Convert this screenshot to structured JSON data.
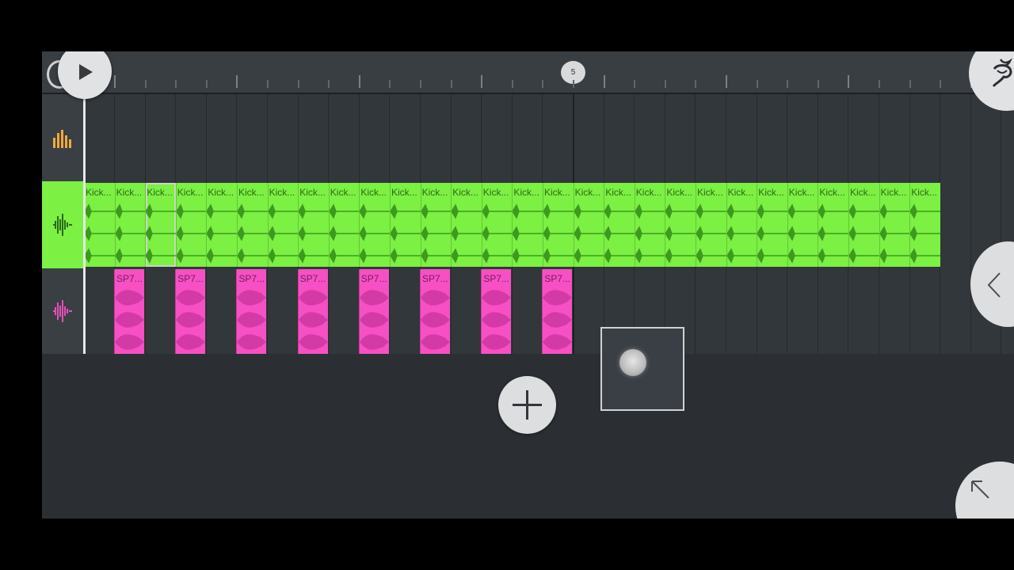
{
  "ruler": {
    "bar_marker": "5"
  },
  "tracks": [
    {
      "name": "track-1-mixer",
      "icon": "mixer-bars-icon",
      "color": "#f2a93b"
    },
    {
      "name": "track-2-kick",
      "icon": "waveform-icon",
      "color": "#7cf043",
      "clip_label": "Kick...",
      "clip_count": 28
    },
    {
      "name": "track-3-sample",
      "icon": "waveform-icon",
      "color": "#f650c4",
      "clip_label": "SP7...",
      "clip_count": 8
    }
  ],
  "controls": {
    "play_icon": "play-icon",
    "logo_icon": "fruit-logo-icon",
    "add_icon": "plus-icon",
    "side_icon": "chevron-left-icon",
    "corner_icon": "arrow-up-left-icon",
    "drag_icon": "drag-knob-icon"
  }
}
